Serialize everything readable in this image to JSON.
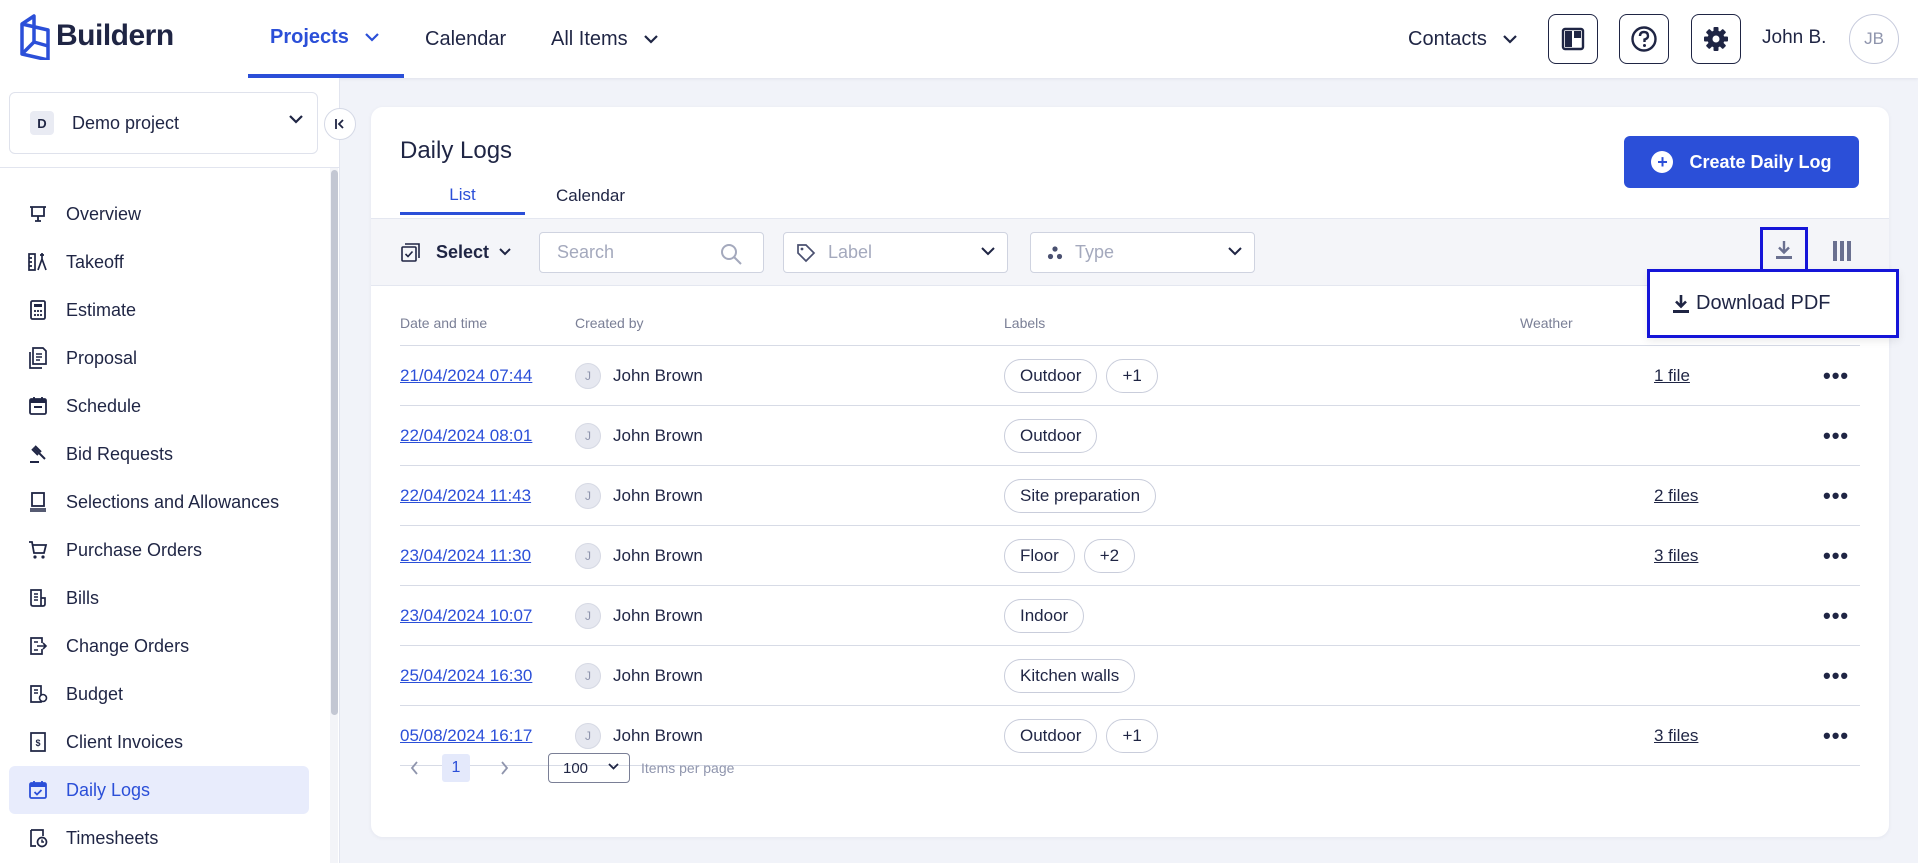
{
  "app": {
    "name": "Buildern"
  },
  "topnav": {
    "projects": "Projects",
    "calendar": "Calendar",
    "all_items": "All Items",
    "contacts": "Contacts",
    "user_name": "John B.",
    "user_initials": "JB"
  },
  "sidebar": {
    "project_initial": "D",
    "project_name": "Demo project",
    "items": [
      {
        "label": "Overview",
        "icon": "presentation-board-icon"
      },
      {
        "label": "Takeoff",
        "icon": "measure-icon"
      },
      {
        "label": "Estimate",
        "icon": "calculator-icon"
      },
      {
        "label": "Proposal",
        "icon": "proposal-document-icon"
      },
      {
        "label": "Schedule",
        "icon": "calendar-icon"
      },
      {
        "label": "Bid Requests",
        "icon": "gavel-icon"
      },
      {
        "label": "Selections and Allowances",
        "icon": "selection-icon"
      },
      {
        "label": "Purchase Orders",
        "icon": "cart-icon"
      },
      {
        "label": "Bills",
        "icon": "bill-icon"
      },
      {
        "label": "Change Orders",
        "icon": "change-order-icon"
      },
      {
        "label": "Budget",
        "icon": "budget-icon"
      },
      {
        "label": "Client Invoices",
        "icon": "invoice-icon"
      },
      {
        "label": "Daily Logs",
        "icon": "calendar-check-icon",
        "active": true
      },
      {
        "label": "Timesheets",
        "icon": "timesheet-icon"
      }
    ]
  },
  "main": {
    "title": "Daily Logs",
    "tabs": [
      {
        "label": "List",
        "active": true
      },
      {
        "label": "Calendar"
      }
    ],
    "create_button": "Create Daily Log",
    "toolbar": {
      "select_label": "Select",
      "search_placeholder": "Search",
      "label_placeholder": "Label",
      "type_placeholder": "Type"
    },
    "download_menu": {
      "item": "Download PDF"
    },
    "table": {
      "columns": [
        "Date and time",
        "Created by",
        "Labels",
        "Weather"
      ],
      "rows": [
        {
          "date": "21/04/2024 07:44",
          "initial": "J",
          "creator": "John Brown",
          "labels": [
            "Outdoor",
            "+1"
          ],
          "files": "1 file"
        },
        {
          "date": "22/04/2024 08:01",
          "initial": "J",
          "creator": "John Brown",
          "labels": [
            "Outdoor"
          ],
          "files": ""
        },
        {
          "date": "22/04/2024 11:43",
          "initial": "J",
          "creator": "John Brown",
          "labels": [
            "Site preparation"
          ],
          "files": "2 files"
        },
        {
          "date": "23/04/2024 11:30",
          "initial": "J",
          "creator": "John Brown",
          "labels": [
            "Floor",
            "+2"
          ],
          "files": "3 files"
        },
        {
          "date": "23/04/2024 10:07",
          "initial": "J",
          "creator": "John Brown",
          "labels": [
            "Indoor"
          ],
          "files": ""
        },
        {
          "date": "25/04/2024 16:30",
          "initial": "J",
          "creator": "John Brown",
          "labels": [
            "Kitchen walls"
          ],
          "files": ""
        },
        {
          "date": "05/08/2024 16:17",
          "initial": "J",
          "creator": "John Brown",
          "labels": [
            "Outdoor",
            "+1"
          ],
          "files": "3 files"
        }
      ]
    },
    "pagination": {
      "current_page": "1",
      "per_page": "100",
      "per_page_label": "Items per page"
    }
  },
  "colors": {
    "accent": "#2b4fd8",
    "text": "#1f2544",
    "highlight": "#1515d8"
  }
}
